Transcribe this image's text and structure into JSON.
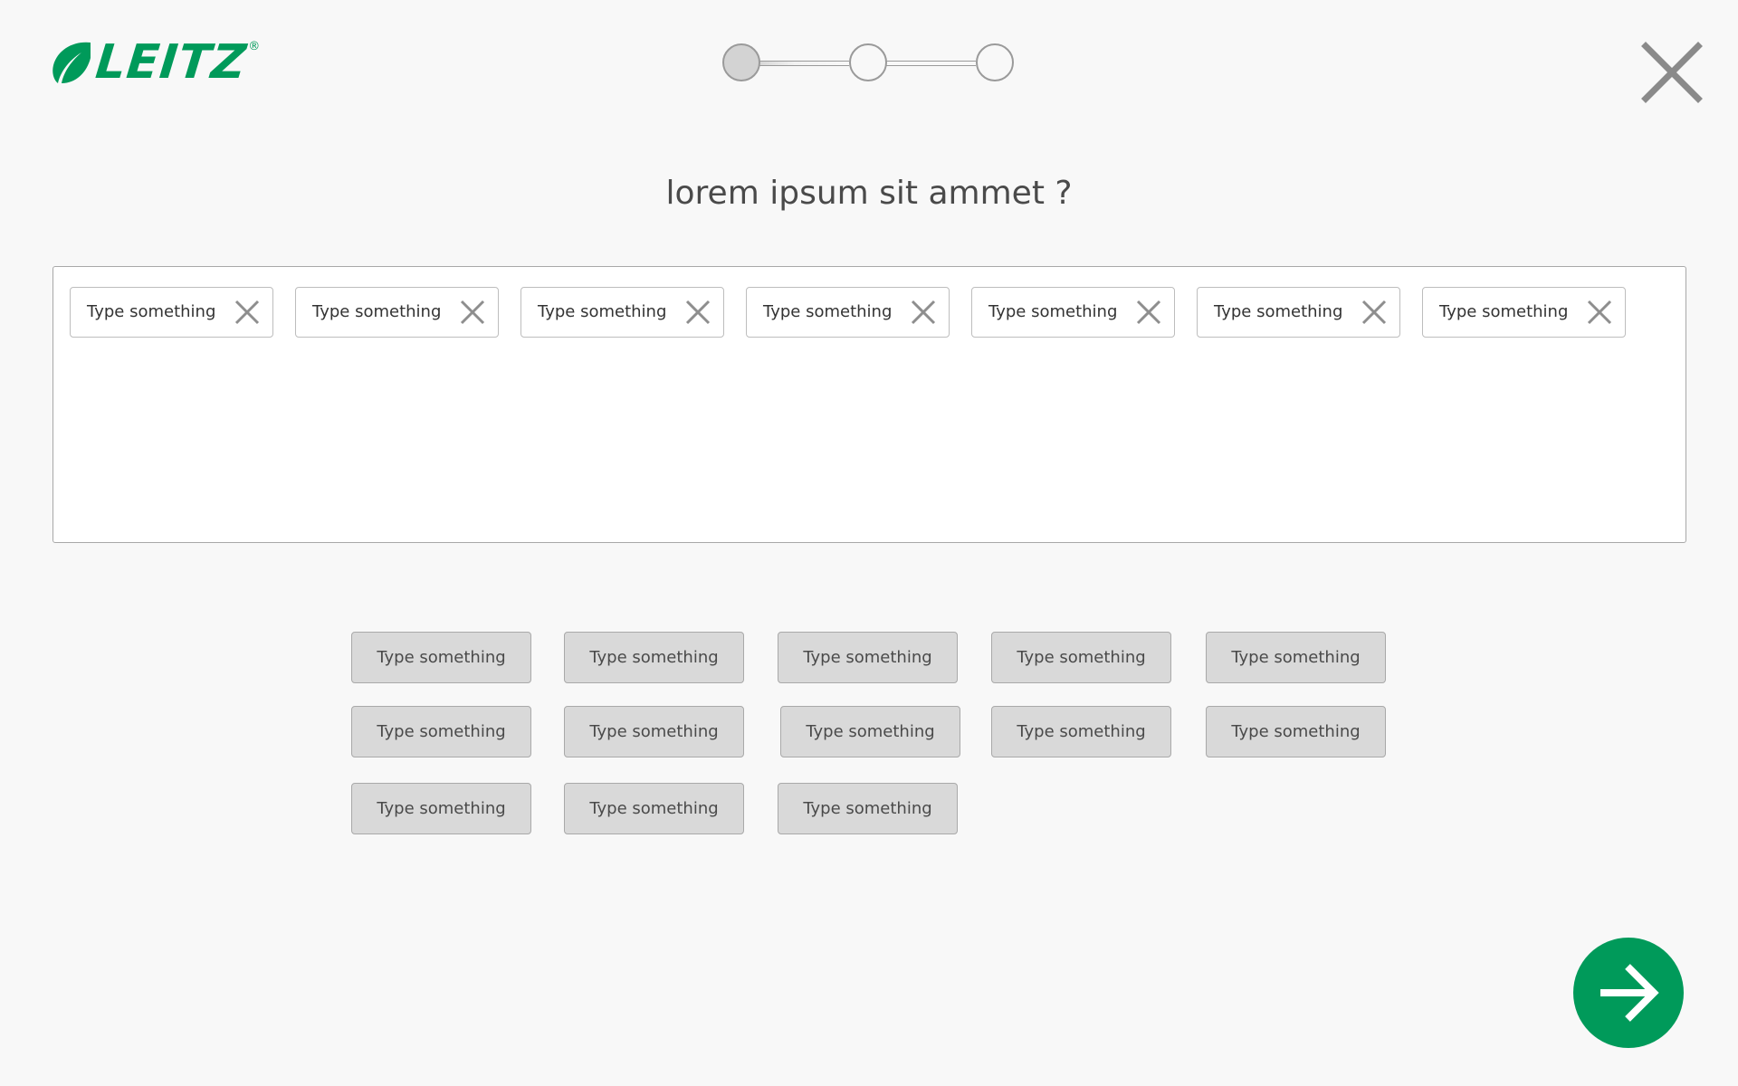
{
  "brand": {
    "name": "LEITZ",
    "registered_mark": "®",
    "color": "#009a5a"
  },
  "stepper": {
    "total_steps": 3,
    "current_step": 1
  },
  "header": {
    "close_icon": "close-icon"
  },
  "question": {
    "text": "lorem ipsum sit ammet ?"
  },
  "selected_tags": [
    {
      "label": "Type something"
    },
    {
      "label": "Type something"
    },
    {
      "label": "Type something"
    },
    {
      "label": "Type something"
    },
    {
      "label": "Type something"
    },
    {
      "label": "Type something"
    },
    {
      "label": "Type something"
    }
  ],
  "options": [
    {
      "label": "Type something"
    },
    {
      "label": "Type something"
    },
    {
      "label": "Type something"
    },
    {
      "label": "Type something"
    },
    {
      "label": "Type something"
    },
    {
      "label": "Type something"
    },
    {
      "label": "Type something"
    },
    {
      "label": "Type something"
    },
    {
      "label": "Type something"
    },
    {
      "label": "Type something"
    },
    {
      "label": "Type something"
    },
    {
      "label": "Type something"
    },
    {
      "label": "Type something"
    }
  ],
  "next_button": {
    "icon": "arrow-right-icon",
    "color": "#009a5a"
  }
}
